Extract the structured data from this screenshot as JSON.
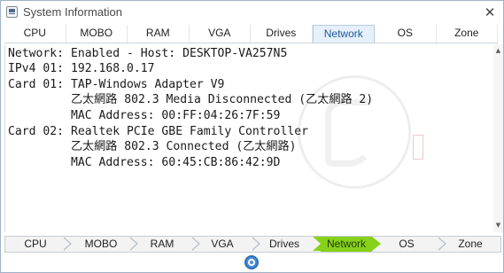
{
  "window": {
    "title": "System Information",
    "close_glyph": "✕"
  },
  "tabs_top": [
    {
      "label": "CPU",
      "active": false
    },
    {
      "label": "MOBO",
      "active": false
    },
    {
      "label": "RAM",
      "active": false
    },
    {
      "label": "VGA",
      "active": false
    },
    {
      "label": "Drives",
      "active": false
    },
    {
      "label": "Network",
      "active": true
    },
    {
      "label": "OS",
      "active": false
    },
    {
      "label": "Zone",
      "active": false
    }
  ],
  "content": {
    "lines": [
      "Network: Enabled - Host: DESKTOP-VA257N5",
      "IPv4 01: 192.168.0.17",
      "Card 01: TAP-Windows Adapter V9",
      "         乙太網路 802.3 Media Disconnected (乙太網路 2)",
      "         MAC Address: 00:FF:04:26:7F:59",
      "Card 02: Realtek PCIe GBE Family Controller",
      "         乙太網路 802.3 Connected (乙太網路)",
      "         MAC Address: 60:45:CB:86:42:9D"
    ]
  },
  "tabs_bottom": [
    {
      "label": "CPU",
      "active": false
    },
    {
      "label": "MOBO",
      "active": false
    },
    {
      "label": "RAM",
      "active": false
    },
    {
      "label": "VGA",
      "active": false
    },
    {
      "label": "Drives",
      "active": false
    },
    {
      "label": "Network",
      "active": true
    },
    {
      "label": "OS",
      "active": false
    },
    {
      "label": "Zone",
      "active": false
    }
  ],
  "scrollbar": {
    "up_glyph": "▲",
    "down_glyph": "▼"
  },
  "colors": {
    "accent_tab": "#1d5aa0",
    "active_breadcrumb": "#86d21a",
    "refresh_icon": "#4a8fd8"
  },
  "icons": {
    "app": "app-icon",
    "close": "close-icon",
    "refresh": "refresh-icon"
  }
}
